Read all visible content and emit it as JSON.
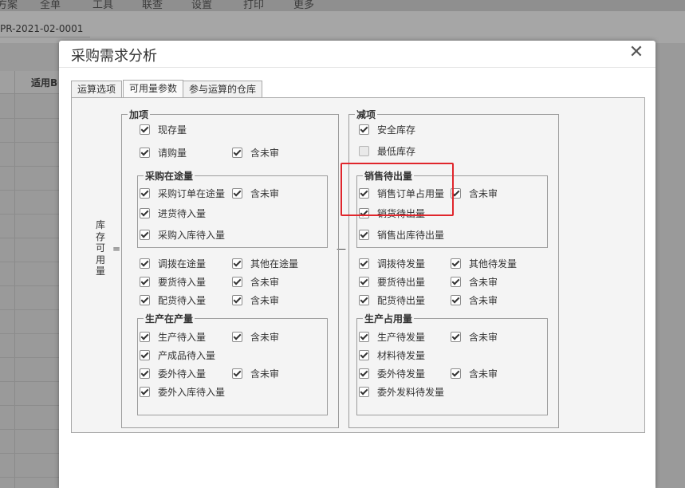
{
  "background": {
    "menu_items": [
      "方案",
      "全单",
      "工具",
      "联查",
      "设置",
      "打印",
      "更多"
    ],
    "doc_no": "PR-2021-02-0001",
    "grid_header": "适用BOM"
  },
  "dialog": {
    "title": "采购需求分析",
    "tabs": [
      {
        "label": "运算选项",
        "active": false
      },
      {
        "label": "可用量参数",
        "active": true
      },
      {
        "label": "参与运算的仓库",
        "active": false
      }
    ],
    "equation": {
      "left_label": [
        "库",
        "存",
        "可",
        "用",
        "量"
      ],
      "equals": "=",
      "minus": "—"
    },
    "add_section": {
      "legend": "加项",
      "onhand": {
        "label": "现存量",
        "checked": true
      },
      "requisition": {
        "label": "请购量",
        "checked": true
      },
      "requisition_unapproved": {
        "label": "含未审",
        "checked": true
      },
      "purchase_in_transit": {
        "legend": "采购在途量",
        "po_in_transit": {
          "label": "采购订单在途量",
          "checked": true
        },
        "po_unapproved": {
          "label": "含未审",
          "checked": true
        },
        "receipt_pending": {
          "label": "进货待入量",
          "checked": true
        },
        "purchase_inbound_pending": {
          "label": "采购入库待入量",
          "checked": true
        }
      },
      "transfer_in_transit": {
        "label": "调拨在途量",
        "checked": true
      },
      "other_in_transit": {
        "label": "其他在途量",
        "checked": true
      },
      "request_pending_in": {
        "label": "要货待入量",
        "checked": true
      },
      "request_unapproved": {
        "label": "含未审",
        "checked": true
      },
      "distribution_pending_in": {
        "label": "配货待入量",
        "checked": true
      },
      "distribution_unapproved": {
        "label": "含未审",
        "checked": true
      },
      "production_in_process": {
        "legend": "生产在产量",
        "production_pending_in": {
          "label": "生产待入量",
          "checked": true
        },
        "production_unapproved": {
          "label": "含未审",
          "checked": true
        },
        "finished_pending_in": {
          "label": "产成品待入量",
          "checked": true
        },
        "outsource_pending_in": {
          "label": "委外待入量",
          "checked": true
        },
        "outsource_unapproved": {
          "label": "含未审",
          "checked": true
        },
        "outsource_inbound_pending": {
          "label": "委外入库待入量",
          "checked": true
        }
      }
    },
    "subtract_section": {
      "legend": "减项",
      "safety_stock": {
        "label": "安全库存",
        "checked": true
      },
      "min_stock": {
        "label": "最低库存",
        "checked": false
      },
      "sales_pending_out": {
        "legend": "销售待出量",
        "so_occupied": {
          "label": "销售订单占用量",
          "checked": true
        },
        "so_unapproved": {
          "label": "含未审",
          "checked": true
        },
        "sales_delivery_pending": {
          "label": "销货待出量",
          "checked": true
        },
        "sales_outbound_pending": {
          "label": "销售出库待出量",
          "checked": true
        }
      },
      "transfer_pending_out": {
        "label": "调拨待发量",
        "checked": true
      },
      "other_pending_out": {
        "label": "其他待发量",
        "checked": true
      },
      "request_pending_out": {
        "label": "要货待出量",
        "checked": true
      },
      "request_unapproved": {
        "label": "含未审",
        "checked": true
      },
      "distribution_pending_out": {
        "label": "配货待出量",
        "checked": true
      },
      "distribution_unapproved": {
        "label": "含未审",
        "checked": true
      },
      "production_occupied": {
        "legend": "生产占用量",
        "production_pending_out": {
          "label": "生产待发量",
          "checked": true
        },
        "production_unapproved": {
          "label": "含未审",
          "checked": true
        },
        "material_pending_out": {
          "label": "材料待发量",
          "checked": true
        },
        "outsource_pending_out": {
          "label": "委外待发量",
          "checked": true
        },
        "outsource_unapproved": {
          "label": "含未审",
          "checked": true
        },
        "outsource_material_pending_out": {
          "label": "委外发料待发量",
          "checked": true
        }
      }
    }
  },
  "colors": {
    "highlight": "#e0262c",
    "panel_bg": "#f4f4f4"
  }
}
